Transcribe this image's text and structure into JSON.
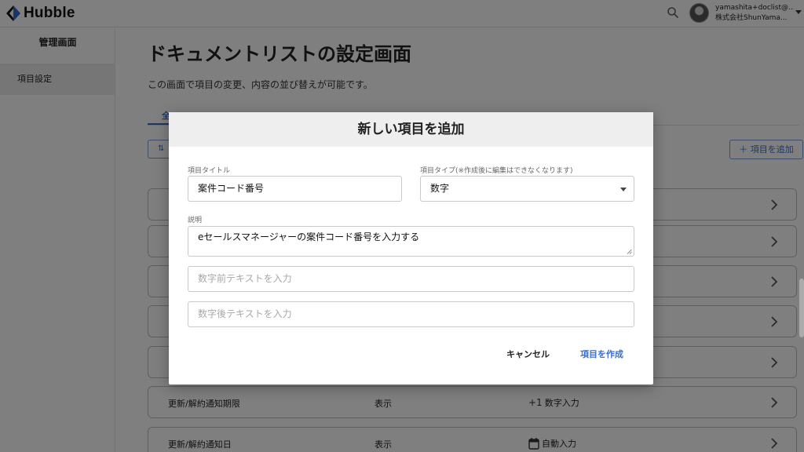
{
  "header": {
    "brand": "Hubble",
    "user_email": "yamashita+doclist@...",
    "user_company": "株式会社ShunYama..."
  },
  "sidebar": {
    "title": "管理画面",
    "items": [
      {
        "label": "項目設定"
      }
    ]
  },
  "main": {
    "title": "ドキュメントリストの設定画面",
    "description": "この画面で項目の変更、内容の並び替えが可能です。",
    "active_tab_fragment": "全",
    "sort_label": "⇅",
    "add_item_label": "＋ 項目を追加",
    "rows": [
      {
        "name": "",
        "visibility": "",
        "type": ""
      },
      {
        "name": "",
        "visibility": "",
        "type": ""
      },
      {
        "name": "",
        "visibility": "",
        "type": ""
      },
      {
        "name": "",
        "visibility": "",
        "type": ""
      },
      {
        "name": "",
        "visibility": "",
        "type": ""
      },
      {
        "name": "更新/解約通知期限",
        "visibility": "表示",
        "type_icon": "plus-one-icon",
        "type_icon_text": "+1",
        "type": "数字入力"
      },
      {
        "name": "更新/解約通知日",
        "visibility": "表示",
        "type_icon": "calendar-icon",
        "type": "自動入力"
      }
    ]
  },
  "modal": {
    "title": "新しい項目を追加",
    "item_title_label": "項目タイトル",
    "item_title_value": "案件コード番号",
    "item_type_label": "項目タイプ(※作成後に編集はできなくなります)",
    "item_type_value": "数字",
    "description_label": "説明",
    "description_value": "eセールスマネージャーの案件コード番号を入力する",
    "prefix_placeholder": "数字前テキストを入力",
    "suffix_placeholder": "数字後テキストを入力",
    "cancel_label": "キャンセル",
    "create_label": "項目を作成"
  },
  "colors": {
    "accent": "#3f6fc7",
    "overlay": "rgba(0,0,0,0.5)"
  }
}
